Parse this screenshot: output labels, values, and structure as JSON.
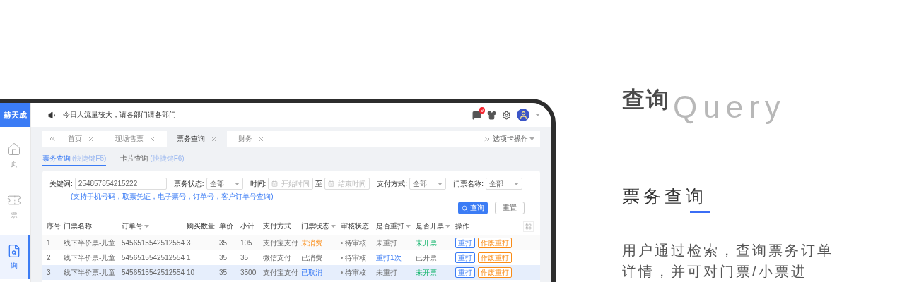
{
  "sidebar": {
    "logo": "赫天成",
    "items": [
      {
        "label": "页",
        "kind": "home",
        "selected": false
      },
      {
        "label": "票",
        "kind": "ticket",
        "selected": false
      },
      {
        "label": "询",
        "kind": "search",
        "selected": true
      }
    ]
  },
  "topbar": {
    "notice": "今日人流量较大，请各部门请各部门",
    "message_badge": "9"
  },
  "tabs": [
    {
      "label": "首页",
      "selected": false
    },
    {
      "label": "现场售票",
      "selected": false
    },
    {
      "label": "票务查询",
      "selected": true
    },
    {
      "label": "财务",
      "selected": false
    }
  ],
  "tab_actions": "选项卡操作",
  "subtabs": [
    {
      "label": "票务查询",
      "hint": "(快捷键F5)",
      "selected": true
    },
    {
      "label": "卡片查询",
      "hint": "(快捷键F6)",
      "selected": false
    }
  ],
  "filters": {
    "keyword_label": "关键词:",
    "keyword_value": "254857854215222",
    "keyword_hint": "(支持手机号码，取票凭证，电子票号，订单号，客户订单号查询)",
    "status_label": "票务状态:",
    "status_value": "全部",
    "time_label": "时间:",
    "start_placeholder": "开始时间",
    "to": "至",
    "end_placeholder": "结束时间",
    "pay_label": "支付方式:",
    "pay_value": "全部",
    "name_label": "门票名称:",
    "name_value": "全部",
    "search_button": "查询",
    "reset_button": "重置"
  },
  "table": {
    "columns": [
      {
        "label": "序号",
        "dropdown": false
      },
      {
        "label": "门票名称",
        "dropdown": false
      },
      {
        "label": "订单号",
        "dropdown": true
      },
      {
        "label": "购买数量",
        "dropdown": false
      },
      {
        "label": "单价",
        "dropdown": false
      },
      {
        "label": "小计",
        "dropdown": false
      },
      {
        "label": "支付方式",
        "dropdown": false
      },
      {
        "label": "门票状态",
        "dropdown": true
      },
      {
        "label": "审核状态",
        "dropdown": false
      },
      {
        "label": "是否重打",
        "dropdown": true
      },
      {
        "label": "是否开票",
        "dropdown": true
      },
      {
        "label": "操作",
        "dropdown": false
      }
    ],
    "rows": [
      {
        "selected": false,
        "no": "1",
        "name": "线下半价票-儿童",
        "order": "5456515542512554",
        "qty": "3",
        "price": "35",
        "subtotal": "105",
        "pay": "支付宝支付",
        "ticket_status": {
          "text": "未消费",
          "kind": "unused"
        },
        "audit": "待审核",
        "reprint": {
          "text": "未重打",
          "kind": "none"
        },
        "invoice": {
          "text": "未开票",
          "kind": "no"
        },
        "actions": [
          "重打",
          "作废重打"
        ]
      },
      {
        "selected": false,
        "no": "2",
        "name": "线下半价票-儿童",
        "order": "5456515542512554",
        "qty": "1",
        "price": "35",
        "subtotal": "35",
        "pay": "微信支付",
        "ticket_status": {
          "text": "已消费",
          "kind": "used"
        },
        "audit": "待审核",
        "reprint": {
          "text": "重打1次",
          "kind": "done"
        },
        "invoice": {
          "text": "已开票",
          "kind": "yes"
        },
        "actions": [
          "重打",
          "作废重打"
        ]
      },
      {
        "selected": true,
        "no": "3",
        "name": "线下半价票-儿童",
        "order": "5456515542512554",
        "qty": "10",
        "price": "35",
        "subtotal": "3500",
        "pay": "支付宝支付",
        "ticket_status": {
          "text": "已取消",
          "kind": "cancelled"
        },
        "audit": "待审核",
        "reprint": {
          "text": "未重打",
          "kind": "none"
        },
        "invoice": {
          "text": "未开票",
          "kind": "no"
        },
        "actions": [
          "重打",
          "作废重打"
        ]
      }
    ]
  },
  "feature": {
    "title": "查询",
    "title_en": "Query",
    "subtitle": "票务查询",
    "description": "用户通过检索，查询票务订单详情，并可对门票/小票进"
  }
}
